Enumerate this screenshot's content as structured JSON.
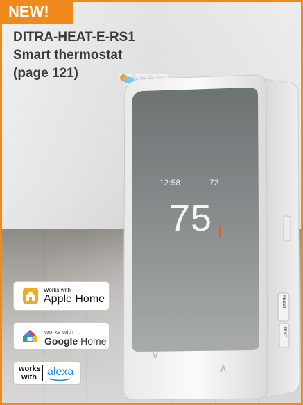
{
  "badge": {
    "text": "NEW!"
  },
  "title": {
    "model": "DITRA-HEAT-E-RS1",
    "name": "Smart thermostat",
    "page_ref": "(page 121)"
  },
  "thermostat": {
    "clock": "12:58",
    "outdoor_temp": "72",
    "set_temp": "75",
    "weather_icon": "partly-cloudy-icon",
    "side_labels": [
      "RESET",
      "TEST"
    ]
  },
  "compatibility": {
    "apple": {
      "small": "Works with",
      "big": "Apple Home"
    },
    "google": {
      "small": "works with",
      "big_strong": "Google",
      "big_light": " Home"
    },
    "alexa": {
      "works": "works with",
      "word": "alexa"
    }
  },
  "colors": {
    "accent": "#f08a1c",
    "screen": "#8a8f90",
    "device": "#f5f5f4"
  }
}
